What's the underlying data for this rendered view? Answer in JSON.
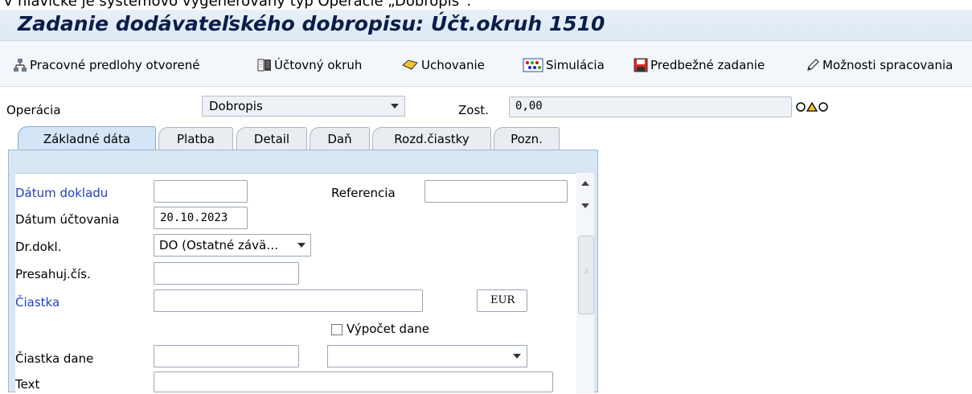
{
  "fragment_text": "V hlavičke je systémovo vygenerovaný typ Operácie „Dobropis“.",
  "title": "Zadanie dodávateľského dobropisu: Účt.okruh 1510",
  "toolbar": {
    "worklist": "Pracovné predlohy otvorené",
    "company_code": "Účtovný okruh",
    "hold": "Uchovanie",
    "simulate": "Simulácia",
    "park": "Predbežné zadanie",
    "options": "Možnosti spracovania"
  },
  "header": {
    "operation_label": "Operácia",
    "operation_value": "Dobropis",
    "balance_label": "Zost.",
    "balance_value": "0,00"
  },
  "tabs": [
    "Základné dáta",
    "Platba",
    "Detail",
    "Daň",
    "Rozd.čiastky",
    "Pozn."
  ],
  "form": {
    "doc_date_label": "Dátum dokladu",
    "doc_date_value": "",
    "reference_label": "Referencia",
    "reference_value": "",
    "posting_date_label": "Dátum účtovania",
    "posting_date_value": "20.10.2023",
    "doc_type_label": "Dr.dokl.",
    "doc_type_value": "DO (Ostatné závä…",
    "cross_cc_label": "Presahuj.čís.",
    "cross_cc_value": "",
    "amount_label": "Čiastka",
    "amount_value": "",
    "currency_value": "EUR",
    "calc_tax_label": "Výpočet dane",
    "tax_amount_label": "Čiastka dane",
    "tax_amount_value": "",
    "tax_code_value": "",
    "text_label": "Text",
    "text_value": ""
  },
  "colors": {
    "title": "#0b1d4a",
    "required_label": "#1f3fbf",
    "tab_active": "#d4e5f7"
  }
}
